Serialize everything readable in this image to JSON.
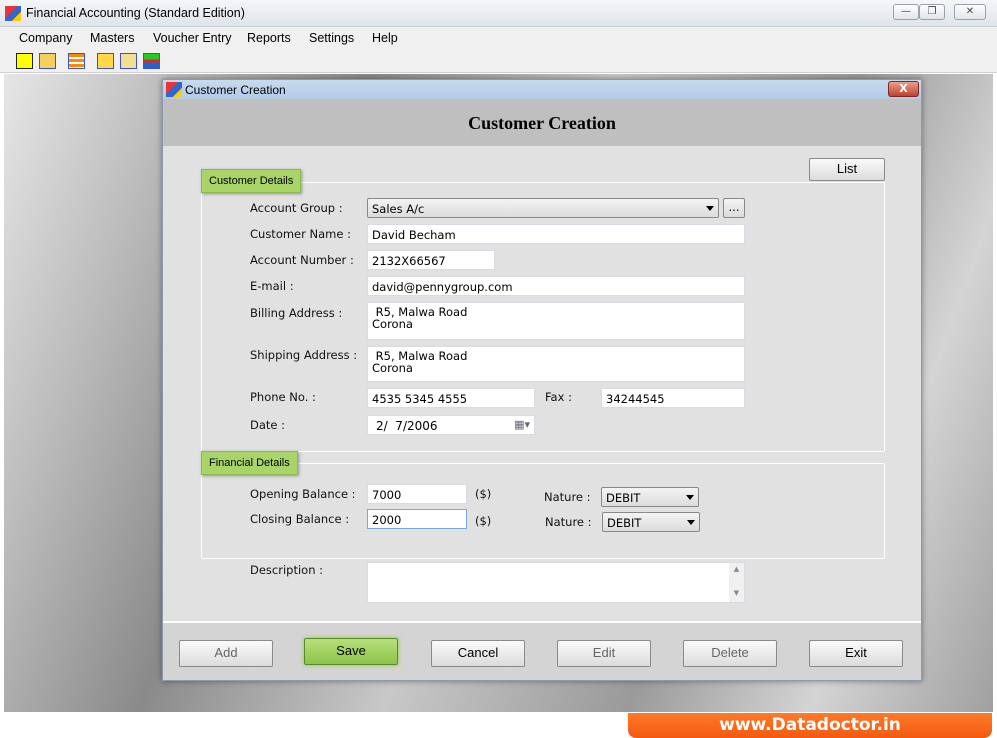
{
  "app": {
    "title": "Financial Accounting (Standard Edition)"
  },
  "menu": [
    "Company",
    "Masters",
    "Voucher Entry",
    "Reports",
    "Settings",
    "Help"
  ],
  "toolbar": [
    "new-icon",
    "open-icon",
    "calculator-icon",
    "balance-scale-icon",
    "note-icon",
    "add-remove-icon"
  ],
  "dialog": {
    "window_title": "Customer Creation",
    "heading": "Customer Creation",
    "list_label": "List",
    "customer_details": {
      "legend": "Customer Details",
      "account_group": {
        "label": "Account Group :",
        "value": "Sales A/c",
        "browse": "..."
      },
      "customer_name": {
        "label": "Customer Name :",
        "value": "David Becham"
      },
      "account_number": {
        "label": "Account Number :",
        "value": "2132X66567"
      },
      "email": {
        "label": "E-mail :",
        "value": "david@pennygroup.com"
      },
      "billing_address": {
        "label": "Billing Address :",
        "line1": " R5, Malwa Road",
        "line2": "Corona"
      },
      "shipping_address": {
        "label": "Shipping Address :",
        "line1": " R5, Malwa Road",
        "line2": "Corona"
      },
      "phone": {
        "label": "Phone No. :",
        "value": "4535 5345 4555"
      },
      "fax": {
        "label": "Fax :",
        "value": "34244545"
      },
      "date": {
        "label": "Date :",
        "value": "2/  7/2006"
      }
    },
    "financial_details": {
      "legend": "Financial Details",
      "opening_balance": {
        "label": "Opening Balance :",
        "value": "7000",
        "unit": "($)",
        "nature_label": "Nature :",
        "nature": "DEBIT"
      },
      "closing_balance": {
        "label": "Closing Balance :",
        "value": "2000",
        "unit": "($)",
        "nature_label": "Nature :",
        "nature": "DEBIT"
      }
    },
    "description": {
      "label": "Description :",
      "value": ""
    },
    "buttons": {
      "add": "Add",
      "save": "Save",
      "cancel": "Cancel",
      "edit": "Edit",
      "delete": "Delete",
      "exit": "Exit"
    }
  },
  "brand": "www.Datadoctor.in",
  "colors": {
    "legend_green": "#a8d468",
    "brand_orange": "#f25a10"
  }
}
